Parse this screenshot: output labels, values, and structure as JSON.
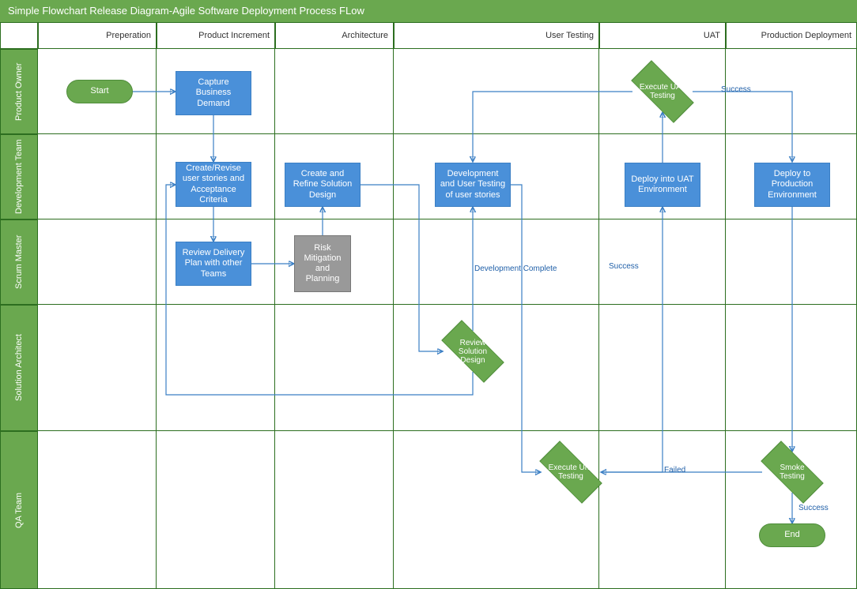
{
  "title": "Simple Flowchart Release Diagram-Agile Software Deployment Process FLow",
  "columns": [
    "Preperation",
    "Product Increment",
    "Architecture",
    "User Testing",
    "UAT",
    "Production Deployment"
  ],
  "rows": [
    "Product Owner",
    "Development Team",
    "Scrum Master",
    "Solution Architect",
    "QA Team"
  ],
  "nodes": {
    "start": "Start",
    "capture": "Capture Business Demand",
    "stories": "Create/Revise user stories and Acceptance Criteria",
    "review_plan": "Review Delivery Plan with other Teams",
    "solution_design": "Create and Refine Solution Design",
    "risk": "Risk Mitigation and Planning",
    "review_solution": "Review Solution Design",
    "dev_test": "Development and User Testing of user stories",
    "exec_unit": "Execute Unit Testing",
    "deploy_uat": "Deploy into UAT Environment",
    "exec_uat": "Execute UAT Testing",
    "smoke": "Smoke Testing",
    "deploy_prod": "Deploy to Production Environment",
    "end": "End"
  },
  "edge_labels": {
    "dev_complete": "Development Complete",
    "success1": "Success",
    "success2": "Success",
    "success3": "Success",
    "failed": "Failed"
  },
  "chart_data": {
    "type": "flowchart-swimlane",
    "lanes_horizontal": [
      "Product Owner",
      "Development Team",
      "Scrum Master",
      "Solution Architect",
      "QA Team"
    ],
    "lanes_vertical": [
      "Preperation",
      "Product Increment",
      "Architecture",
      "User Testing",
      "UAT",
      "Production Deployment"
    ],
    "shapes": [
      {
        "id": "start",
        "type": "terminator",
        "lane_h": "Product Owner",
        "lane_v": "Preperation",
        "label": "Start"
      },
      {
        "id": "capture",
        "type": "process",
        "lane_h": "Product Owner",
        "lane_v": "Product Increment",
        "label": "Capture Business Demand"
      },
      {
        "id": "stories",
        "type": "process",
        "lane_h": "Development Team",
        "lane_v": "Product Increment",
        "label": "Create/Revise user stories and Acceptance Criteria"
      },
      {
        "id": "review_plan",
        "type": "process",
        "lane_h": "Scrum Master",
        "lane_v": "Product Increment",
        "label": "Review Delivery Plan with other Teams"
      },
      {
        "id": "risk",
        "type": "process",
        "lane_h": "Scrum Master",
        "lane_v": "Architecture",
        "label": "Risk Mitigation and Planning"
      },
      {
        "id": "solution_design",
        "type": "process",
        "lane_h": "Development Team",
        "lane_v": "Architecture",
        "label": "Create and Refine Solution Design"
      },
      {
        "id": "review_solution",
        "type": "decision",
        "lane_h": "Solution Architect",
        "lane_v": "User Testing",
        "label": "Review Solution Design"
      },
      {
        "id": "dev_test",
        "type": "process",
        "lane_h": "Development Team",
        "lane_v": "User Testing",
        "label": "Development and User Testing of user stories"
      },
      {
        "id": "exec_unit",
        "type": "decision",
        "lane_h": "QA Team",
        "lane_v": "User Testing",
        "label": "Execute Unit Testing"
      },
      {
        "id": "deploy_uat",
        "type": "process",
        "lane_h": "Development Team",
        "lane_v": "UAT",
        "label": "Deploy into UAT Environment"
      },
      {
        "id": "exec_uat",
        "type": "decision",
        "lane_h": "Product Owner",
        "lane_v": "UAT",
        "label": "Execute UAT Testing"
      },
      {
        "id": "deploy_prod",
        "type": "process",
        "lane_h": "Development Team",
        "lane_v": "Production Deployment",
        "label": "Deploy to Production Environment"
      },
      {
        "id": "smoke",
        "type": "decision",
        "lane_h": "QA Team",
        "lane_v": "Production Deployment",
        "label": "Smoke Testing"
      },
      {
        "id": "end",
        "type": "terminator",
        "lane_h": "QA Team",
        "lane_v": "Production Deployment",
        "label": "End"
      }
    ],
    "edges": [
      {
        "from": "start",
        "to": "capture"
      },
      {
        "from": "capture",
        "to": "stories"
      },
      {
        "from": "stories",
        "to": "review_plan"
      },
      {
        "from": "review_plan",
        "to": "risk"
      },
      {
        "from": "risk",
        "to": "solution_design"
      },
      {
        "from": "solution_design",
        "to": "review_solution"
      },
      {
        "from": "review_solution",
        "to": "dev_test"
      },
      {
        "from": "review_solution",
        "to": "stories",
        "note": "back-loop"
      },
      {
        "from": "dev_test",
        "to": "exec_unit",
        "label": "Development Complete"
      },
      {
        "from": "exec_unit",
        "to": "deploy_uat",
        "label": "Success"
      },
      {
        "from": "deploy_uat",
        "to": "exec_uat"
      },
      {
        "from": "exec_uat",
        "to": "deploy_prod",
        "label": "Success"
      },
      {
        "from": "exec_uat",
        "to": "dev_test",
        "note": "back-loop"
      },
      {
        "from": "deploy_prod",
        "to": "smoke"
      },
      {
        "from": "smoke",
        "to": "exec_unit",
        "label": "Failed"
      },
      {
        "from": "smoke",
        "to": "end",
        "label": "Success"
      }
    ]
  }
}
